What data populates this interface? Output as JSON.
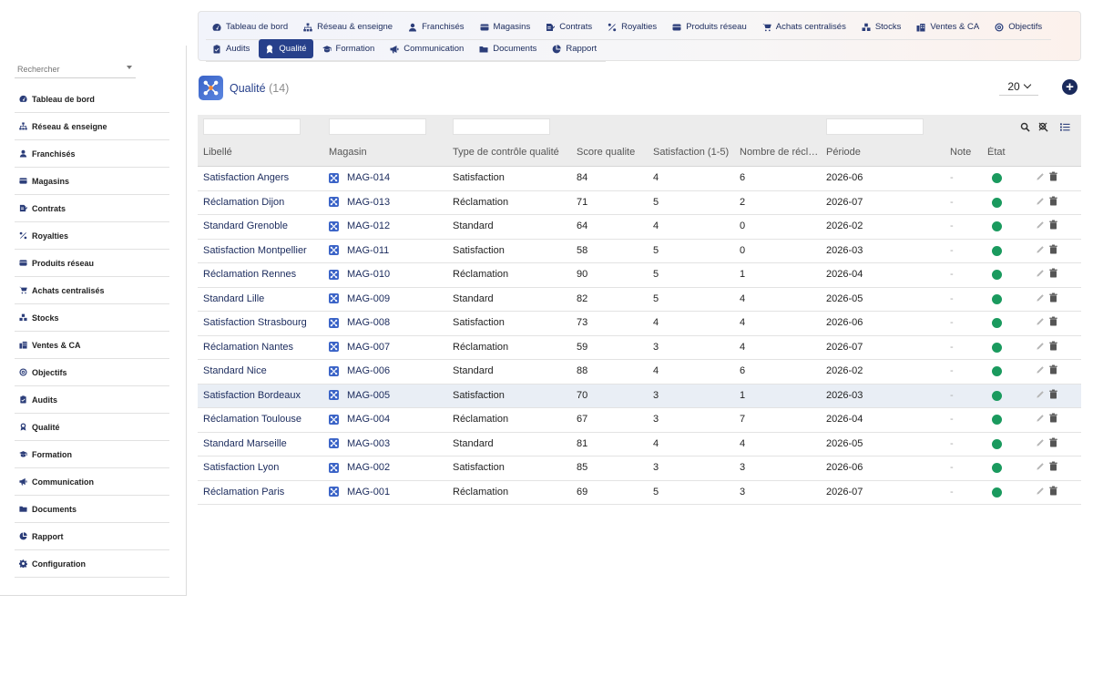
{
  "sidebar": {
    "search_placeholder": "Rechercher",
    "items": [
      {
        "label": "Tableau de bord",
        "icon": "dashboard-icon"
      },
      {
        "label": "Réseau & enseigne",
        "icon": "network-icon"
      },
      {
        "label": "Franchisés",
        "icon": "user-icon"
      },
      {
        "label": "Magasins",
        "icon": "store-icon"
      },
      {
        "label": "Contrats",
        "icon": "contract-icon"
      },
      {
        "label": "Royalties",
        "icon": "percent-icon"
      },
      {
        "label": "Produits réseau",
        "icon": "product-icon"
      },
      {
        "label": "Achats centralisés",
        "icon": "cart-icon"
      },
      {
        "label": "Stocks",
        "icon": "stock-icon"
      },
      {
        "label": "Ventes & CA",
        "icon": "sales-icon"
      },
      {
        "label": "Objectifs",
        "icon": "target-icon"
      },
      {
        "label": "Audits",
        "icon": "audit-icon"
      },
      {
        "label": "Qualité",
        "icon": "quality-icon"
      },
      {
        "label": "Formation",
        "icon": "training-icon"
      },
      {
        "label": "Communication",
        "icon": "megaphone-icon"
      },
      {
        "label": "Documents",
        "icon": "folder-icon"
      },
      {
        "label": "Rapport",
        "icon": "report-icon"
      },
      {
        "label": "Configuration",
        "icon": "gear-icon"
      }
    ]
  },
  "topnav": {
    "row1": [
      "Tableau de bord",
      "Réseau & enseigne",
      "Franchisés",
      "Magasins",
      "Contrats",
      "Royalties",
      "Produits réseau",
      "Achats centralisés",
      "Stocks",
      "Ventes & CA",
      "Objectifs"
    ],
    "row2": [
      "Audits",
      "Qualité",
      "Formation",
      "Communication",
      "Documents",
      "Rapport"
    ],
    "active": "Qualité"
  },
  "page": {
    "title": "Qualité",
    "count": "(14)",
    "per_page": "20",
    "add_label": "+"
  },
  "table": {
    "headers": {
      "libelle": "Libellé",
      "magasin": "Magasin",
      "type": "Type de contrôle qualité",
      "score": "Score qualite",
      "satisfaction": "Satisfaction (1-5)",
      "reclamations": "Nombre de récl…",
      "periode": "Période",
      "note": "Note",
      "etat": "État"
    },
    "rows": [
      {
        "libelle": "Satisfaction Angers",
        "magasin": "MAG-014",
        "type": "Satisfaction",
        "score": "84",
        "satisfaction": "4",
        "reclamations": "6",
        "periode": "2026-06",
        "note": "-"
      },
      {
        "libelle": "Réclamation Dijon",
        "magasin": "MAG-013",
        "type": "Réclamation",
        "score": "71",
        "satisfaction": "5",
        "reclamations": "2",
        "periode": "2026-07",
        "note": "-"
      },
      {
        "libelle": "Standard Grenoble",
        "magasin": "MAG-012",
        "type": "Standard",
        "score": "64",
        "satisfaction": "4",
        "reclamations": "0",
        "periode": "2026-02",
        "note": "-"
      },
      {
        "libelle": "Satisfaction Montpellier",
        "magasin": "MAG-011",
        "type": "Satisfaction",
        "score": "58",
        "satisfaction": "5",
        "reclamations": "0",
        "periode": "2026-03",
        "note": "-"
      },
      {
        "libelle": "Réclamation Rennes",
        "magasin": "MAG-010",
        "type": "Réclamation",
        "score": "90",
        "satisfaction": "5",
        "reclamations": "1",
        "periode": "2026-04",
        "note": "-"
      },
      {
        "libelle": "Standard Lille",
        "magasin": "MAG-009",
        "type": "Standard",
        "score": "82",
        "satisfaction": "5",
        "reclamations": "4",
        "periode": "2026-05",
        "note": "-"
      },
      {
        "libelle": "Satisfaction Strasbourg",
        "magasin": "MAG-008",
        "type": "Satisfaction",
        "score": "73",
        "satisfaction": "4",
        "reclamations": "4",
        "periode": "2026-06",
        "note": "-"
      },
      {
        "libelle": "Réclamation Nantes",
        "magasin": "MAG-007",
        "type": "Réclamation",
        "score": "59",
        "satisfaction": "3",
        "reclamations": "4",
        "periode": "2026-07",
        "note": "-"
      },
      {
        "libelle": "Standard Nice",
        "magasin": "MAG-006",
        "type": "Standard",
        "score": "88",
        "satisfaction": "4",
        "reclamations": "6",
        "periode": "2026-02",
        "note": "-"
      },
      {
        "libelle": "Satisfaction Bordeaux",
        "magasin": "MAG-005",
        "type": "Satisfaction",
        "score": "70",
        "satisfaction": "3",
        "reclamations": "1",
        "periode": "2026-03",
        "note": "-"
      },
      {
        "libelle": "Réclamation Toulouse",
        "magasin": "MAG-004",
        "type": "Réclamation",
        "score": "67",
        "satisfaction": "3",
        "reclamations": "7",
        "periode": "2026-04",
        "note": "-"
      },
      {
        "libelle": "Standard Marseille",
        "magasin": "MAG-003",
        "type": "Standard",
        "score": "81",
        "satisfaction": "4",
        "reclamations": "4",
        "periode": "2026-05",
        "note": "-"
      },
      {
        "libelle": "Satisfaction Lyon",
        "magasin": "MAG-002",
        "type": "Satisfaction",
        "score": "85",
        "satisfaction": "3",
        "reclamations": "3",
        "periode": "2026-06",
        "note": "-"
      },
      {
        "libelle": "Réclamation Paris",
        "magasin": "MAG-001",
        "type": "Réclamation",
        "score": "69",
        "satisfaction": "5",
        "reclamations": "3",
        "periode": "2026-07",
        "note": "-"
      }
    ],
    "highlighted_row": 9,
    "status_color": "#1a9a5e"
  },
  "colors": {
    "accent": "#27408b",
    "link": "#1a2a5c",
    "status_ok": "#1a9a5e"
  }
}
